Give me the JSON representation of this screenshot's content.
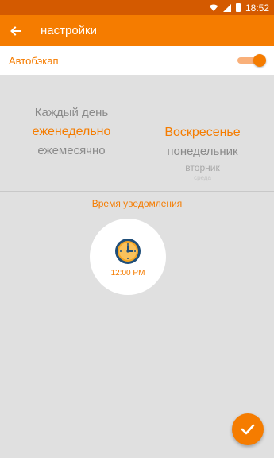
{
  "status_bar": {
    "time": "18:52"
  },
  "app_bar": {
    "title": "настройки"
  },
  "autobackup": {
    "label": "Автобэкап",
    "enabled": true
  },
  "frequency_picker": {
    "above": "Каждый день",
    "selected": "еженедельно",
    "below": "ежемесячно"
  },
  "day_picker": {
    "selected": "Воскресенье",
    "below1": "понедельник",
    "below2": "вторник",
    "below3": "среда"
  },
  "notification": {
    "label": "Время уведомления",
    "time": "12:00 PM"
  },
  "colors": {
    "accent": "#f57c00",
    "status_bar": "#d45a00",
    "background": "#e0e0e0"
  },
  "icons": {
    "back": "arrow-back-icon",
    "clock": "clock-icon",
    "confirm": "checkmark-icon"
  }
}
